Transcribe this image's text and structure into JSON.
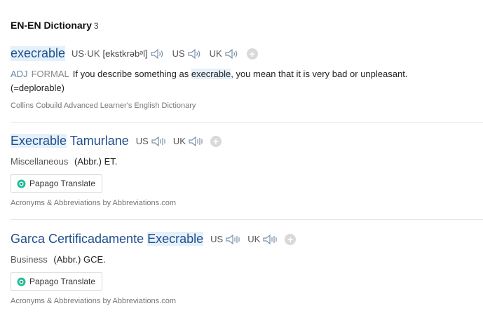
{
  "section": {
    "title": "EN-EN Dictionary",
    "count": "3"
  },
  "entries": [
    {
      "headword": "execrable",
      "pron_label": "US·UK",
      "ipa": "[ekstkrəbᵊl]",
      "us_label": "US",
      "uk_label": "UK",
      "pos": "ADJ",
      "register": "FORMAL",
      "def_before": "If you describe something as",
      "def_keyword": "execrable",
      "def_after": ", you mean that it is very bad or unpleasant.",
      "def_line2": "(=deplorable)",
      "source": "Collins Cobuild Advanced Learner's English Dictionary"
    },
    {
      "headword_hl": "Execrable",
      "headword_rest": " Tamurlane",
      "us_label": "US",
      "uk_label": "UK",
      "category": "Miscellaneous",
      "definition": "(Abbr.) ET.",
      "papago_label": "Papago Translate",
      "source": "Acronyms & Abbreviations by Abbreviations.com"
    },
    {
      "headword_rest": "Garca Certificadamente ",
      "headword_hl": "Execrable",
      "us_label": "US",
      "uk_label": "UK",
      "category": "Business",
      "definition": "(Abbr.) GCE.",
      "papago_label": "Papago Translate",
      "source": "Acronyms & Abbreviations by Abbreviations.com"
    }
  ],
  "colors": {
    "headword": "#1f4e8c",
    "highlight": "#e4f0fa",
    "pos": "#6b86a7",
    "papago": "#1ec38c"
  },
  "icons": [
    "speaker-icon",
    "speaker-wave-icon",
    "plus-icon",
    "papago-icon"
  ]
}
